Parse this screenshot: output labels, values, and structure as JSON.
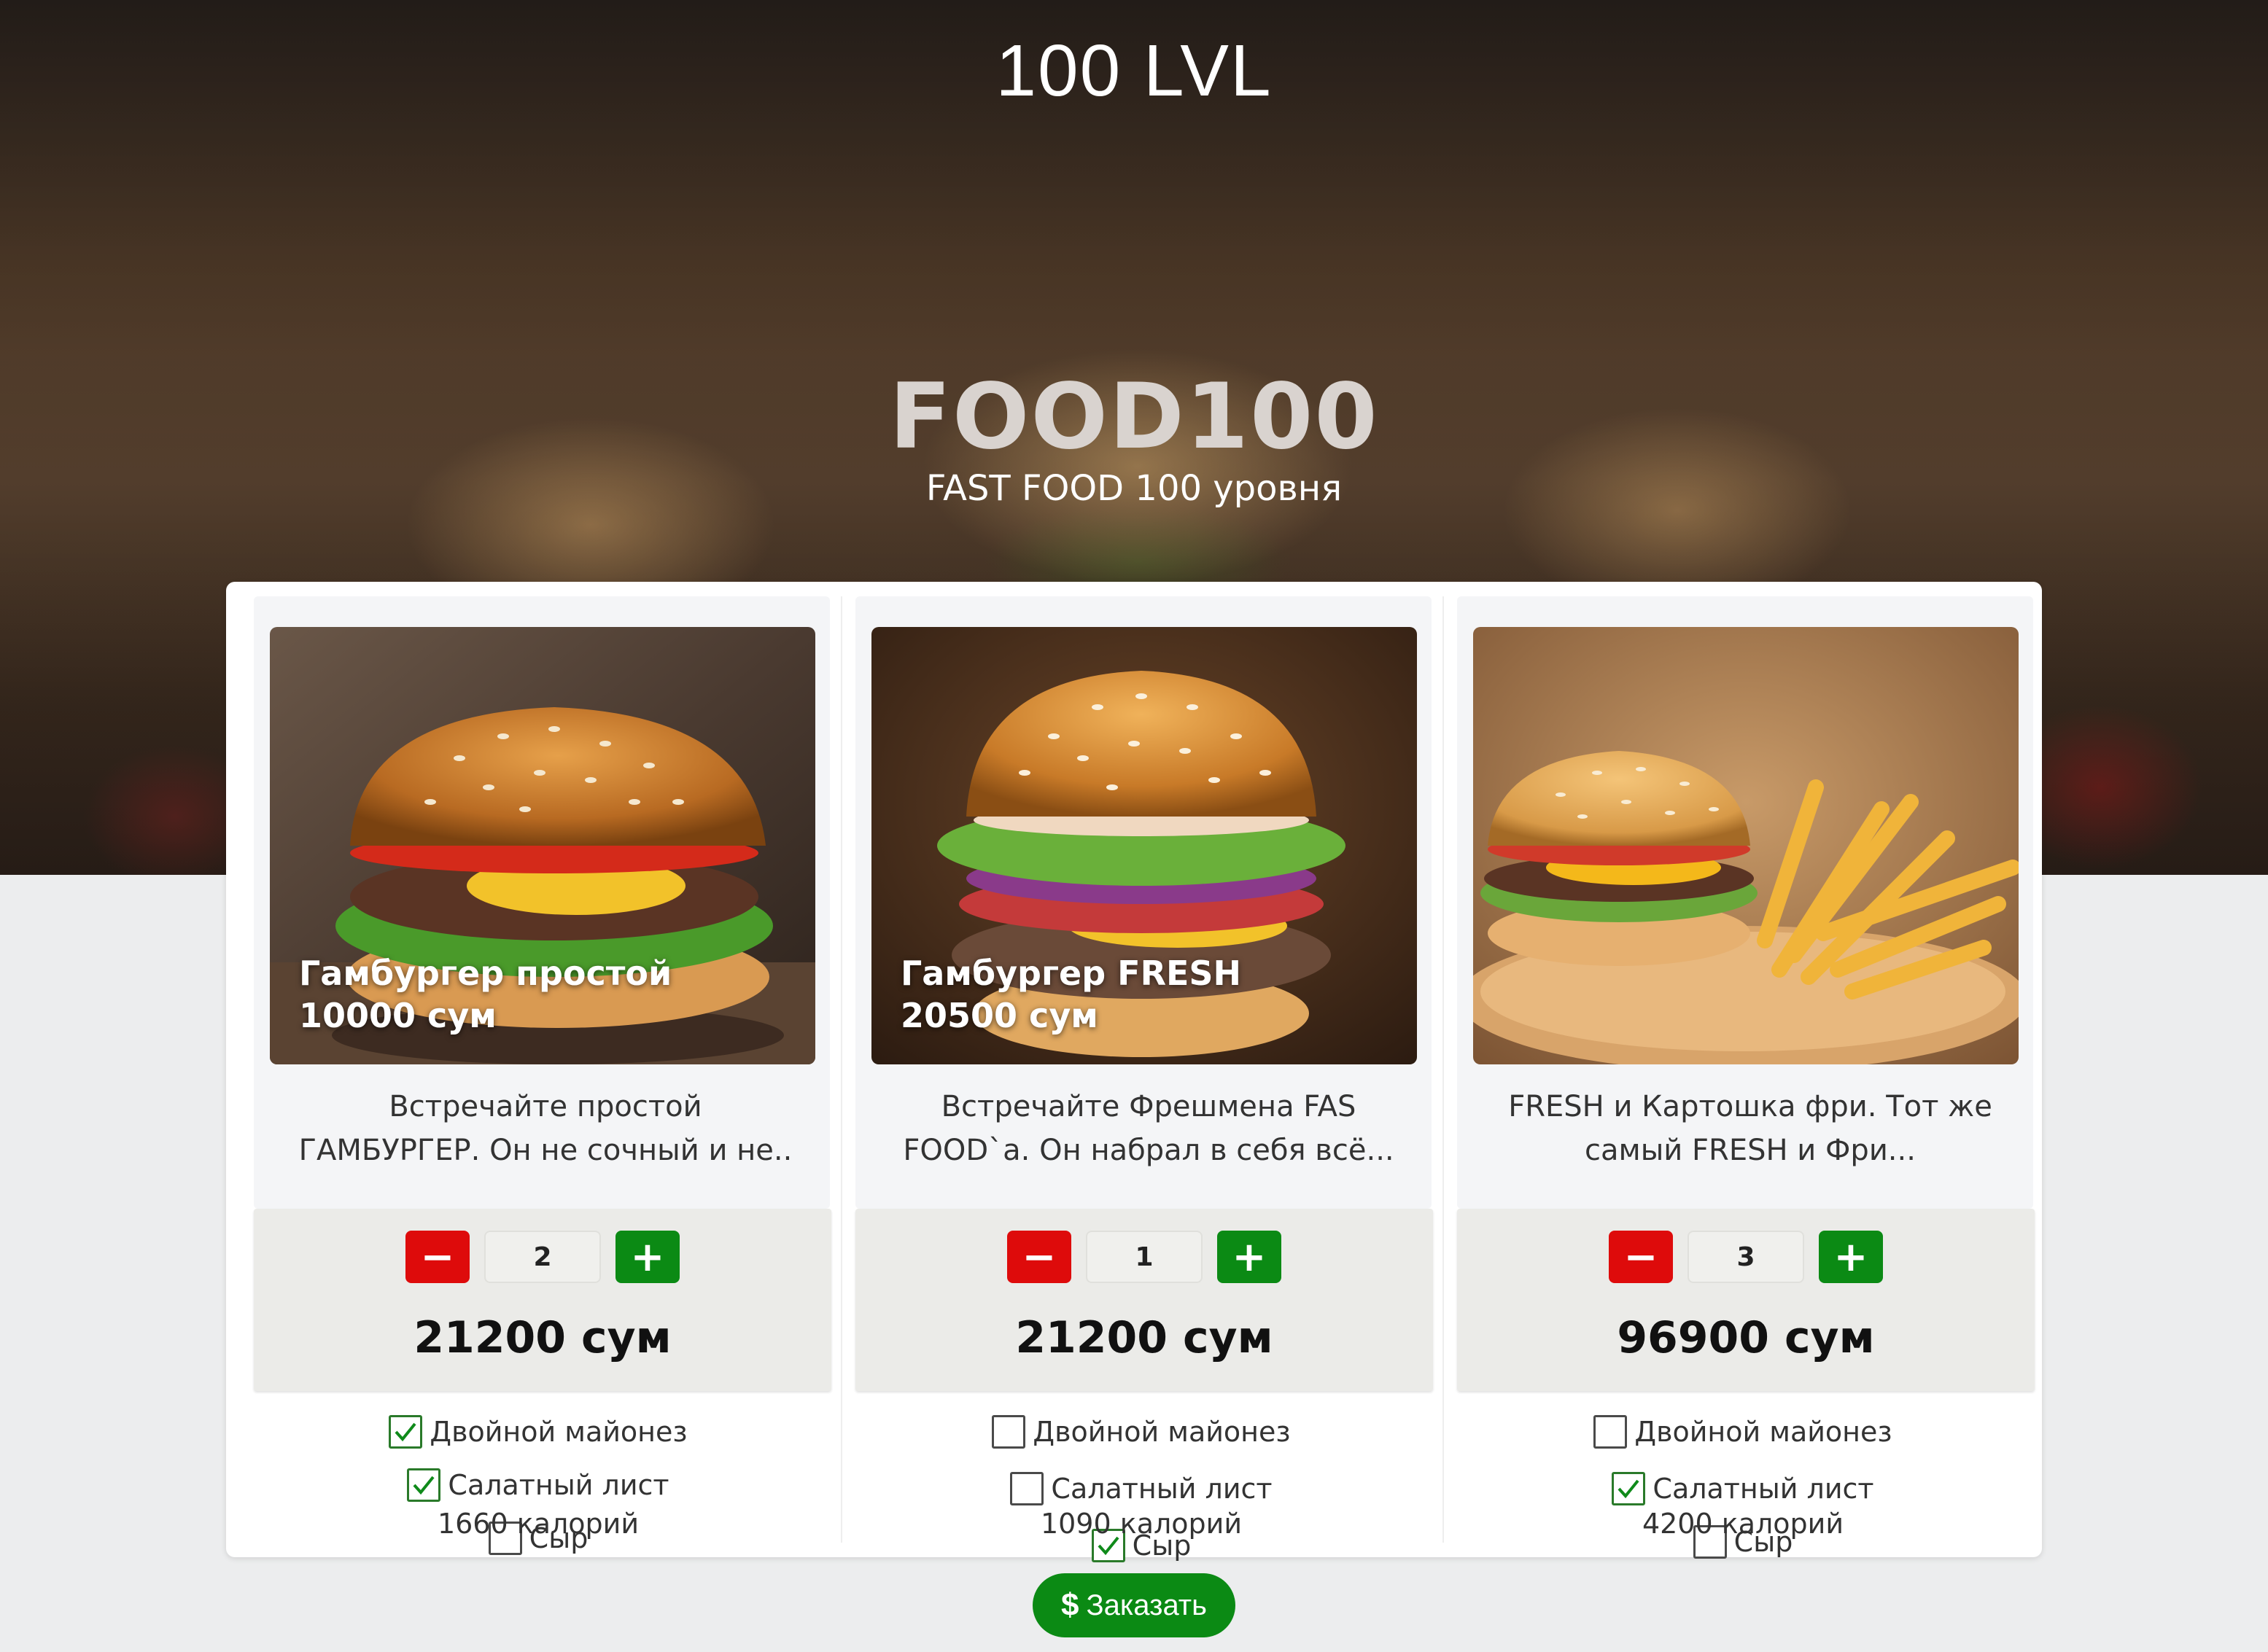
{
  "header": {
    "brand": "100 LVL",
    "title": "FOOD100",
    "subtitle": "FAST FOOD 100 уровня"
  },
  "products": [
    {
      "name": "Гамбургер простой",
      "base_price": "10000 сум",
      "description_line1": "Встречайте простой",
      "description_line2": "ГАМБУРГЕР. Он не сочный и не..",
      "quantity": "2",
      "total": "21200 сум",
      "options": [
        {
          "label": "Двойной майонез",
          "checked": true
        },
        {
          "label": "Салатный лист",
          "checked": true
        },
        {
          "label": "Сыр",
          "checked": false
        }
      ],
      "calories": "1660 калорий"
    },
    {
      "name": "Гамбургер FRESH",
      "base_price": "20500 сум",
      "description_line1": "Встречайте Фрешмена FAS",
      "description_line2": "FOOD`а. Он набрал в себя всё...",
      "quantity": "1",
      "total": "21200 сум",
      "options": [
        {
          "label": "Двойной майонез",
          "checked": false
        },
        {
          "label": "Салатный лист",
          "checked": false
        },
        {
          "label": "Сыр",
          "checked": true
        }
      ],
      "calories": "1090 калорий"
    },
    {
      "name": "",
      "base_price": "",
      "description_line1": "FRESH и Картошка фри. Тот же",
      "description_line2": "самый FRESH и Фри...",
      "quantity": "3",
      "total": "96900 сум",
      "options": [
        {
          "label": "Двойной майонез",
          "checked": false
        },
        {
          "label": "Салатный лист",
          "checked": true
        },
        {
          "label": "Сыр",
          "checked": false
        }
      ],
      "calories": "4200 калорий"
    }
  ],
  "controls": {
    "minus_symbol": "−",
    "plus_symbol": "+"
  },
  "order_button": {
    "icon": "dollar-icon",
    "symbol": "$",
    "label": "Заказать"
  },
  "colors": {
    "minus": "#de0b0b",
    "plus": "#0b8a14",
    "order": "#0b8a14"
  }
}
